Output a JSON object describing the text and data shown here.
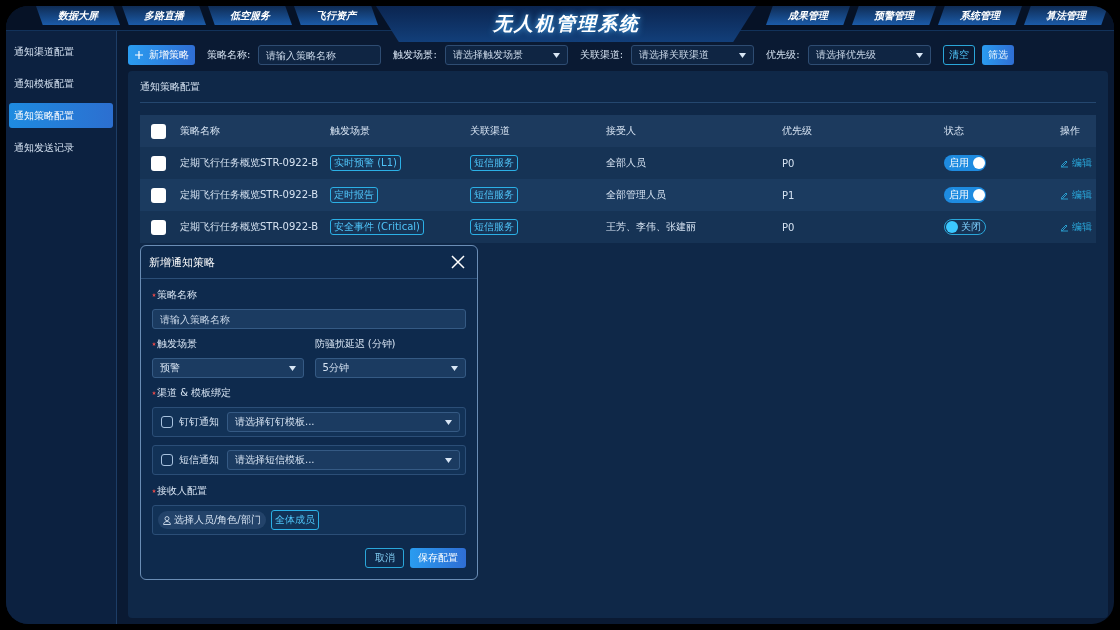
{
  "header": {
    "title": "无人机管理系统",
    "nav_left": [
      "数据大屏",
      "多路直播",
      "低空服务",
      "飞行资产"
    ],
    "nav_right": [
      "成果管理",
      "预警管理",
      "系统管理",
      "算法管理"
    ]
  },
  "sidebar": {
    "items": [
      {
        "label": "通知渠道配置",
        "selected": false
      },
      {
        "label": "通知模板配置",
        "selected": false
      },
      {
        "label": "通知策略配置",
        "selected": true
      },
      {
        "label": "通知发送记录",
        "selected": false
      }
    ]
  },
  "toolbar": {
    "add_button": "新增策略",
    "filters": [
      {
        "label": "策略名称:",
        "kind": "input",
        "placeholder": "请输入策略名称"
      },
      {
        "label": "触发场景:",
        "kind": "select",
        "placeholder": "请选择触发场景"
      },
      {
        "label": "关联渠道:",
        "kind": "select",
        "placeholder": "请选择关联渠道"
      },
      {
        "label": "优先级:",
        "kind": "select",
        "placeholder": "请选择优先级"
      }
    ],
    "clear_button": "清空",
    "filter_button": "筛选"
  },
  "panel": {
    "title": "通知策略配置"
  },
  "table": {
    "header_checked": false,
    "columns": [
      "策略名称",
      "触发场景",
      "关联渠道",
      "接受人",
      "优先级",
      "状态",
      "操作"
    ],
    "rows": [
      {
        "checked": false,
        "name": "定期飞行任务概览STR-0922-B",
        "trigger": "实时预警 (L1)",
        "channel": "短信服务",
        "receiver": "全部人员",
        "priority": "P0",
        "status": {
          "on": true,
          "label": "启用"
        },
        "action": "编辑"
      },
      {
        "checked": false,
        "name": "定期飞行任务概览STR-0922-B",
        "trigger": "定时报告",
        "channel": "短信服务",
        "receiver": "全部管理人员",
        "priority": "P1",
        "status": {
          "on": true,
          "label": "启用"
        },
        "action": "编辑"
      },
      {
        "checked": false,
        "name": "定期飞行任务概览STR-0922-B",
        "trigger": "安全事件 (Critical)",
        "channel": "短信服务",
        "receiver": "王芳、李伟、张建丽",
        "priority": "P0",
        "status": {
          "on": false,
          "label": "关闭"
        },
        "action": "编辑"
      }
    ]
  },
  "dialog": {
    "title": "新增通知策略",
    "name_field": {
      "label": "策略名称",
      "required": true,
      "placeholder": "请输入策略名称"
    },
    "trigger_field": {
      "label": "触发场景",
      "required": true,
      "value": "预警"
    },
    "delay_field": {
      "label": "防骚扰延迟 (分钟)",
      "value": "5分钟"
    },
    "binding": {
      "label": "渠道 & 模板绑定",
      "required": true,
      "channels": [
        {
          "checked": false,
          "label": "钉钉通知",
          "placeholder": "请选择钉钉模板..."
        },
        {
          "checked": false,
          "label": "短信通知",
          "placeholder": "请选择短信模板..."
        }
      ]
    },
    "receivers": {
      "label": "接收人配置",
      "required": true,
      "picker": "选择人员/角色/部门",
      "tag": "全体成员"
    },
    "cancel_button": "取消",
    "save_button": "保存配置"
  }
}
